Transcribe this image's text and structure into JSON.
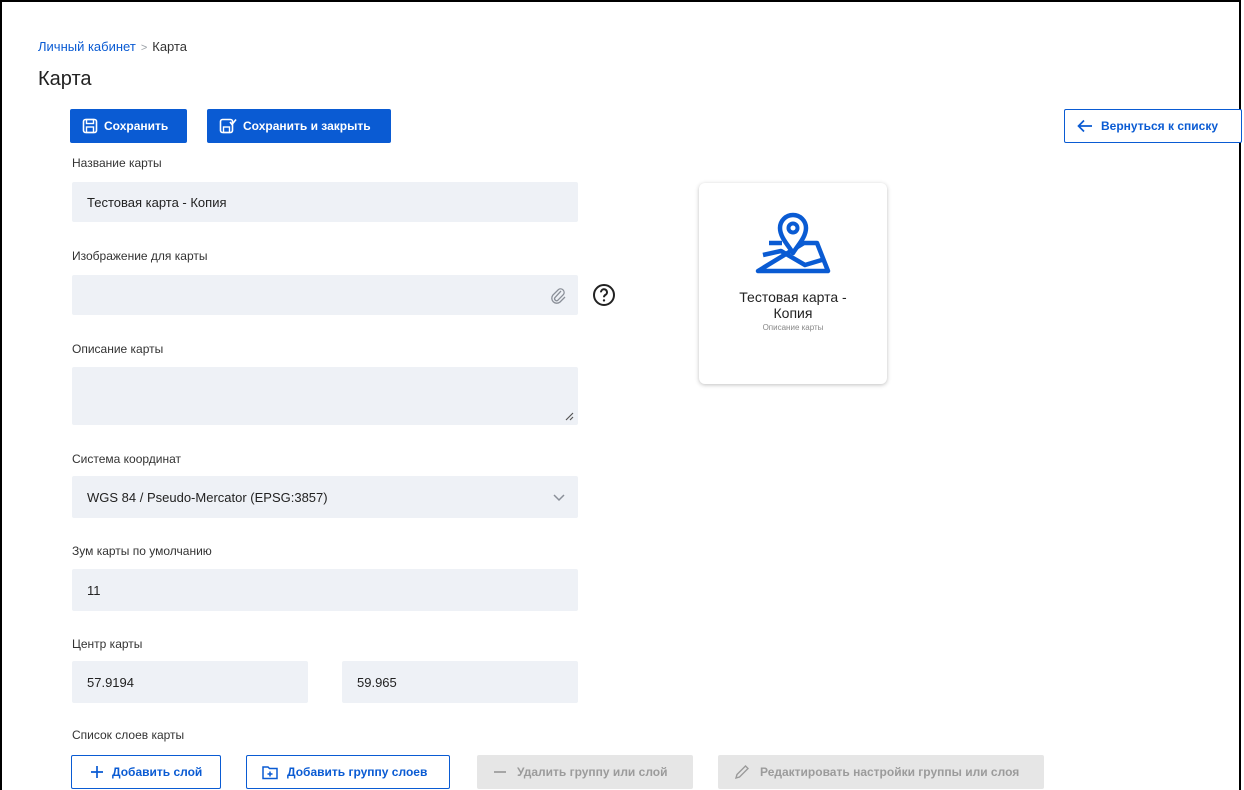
{
  "breadcrumb": {
    "home": "Личный кабинет",
    "separator": ">",
    "current": "Карта"
  },
  "page_title": "Карта",
  "toolbar": {
    "save_label": "Сохранить",
    "save_close_label": "Сохранить и закрыть",
    "back_label": "Вернуться к списку"
  },
  "form": {
    "name": {
      "label": "Название карты",
      "value": "Тестовая карта - Копия"
    },
    "image": {
      "label": "Изображение для карты",
      "value": ""
    },
    "description": {
      "label": "Описание карты",
      "value": ""
    },
    "crs": {
      "label": "Система координат",
      "value": "WGS 84 / Pseudo-Mercator (EPSG:3857)"
    },
    "zoom": {
      "label": "Зум карты по умолчанию",
      "value": "11"
    },
    "center": {
      "label": "Центр карты",
      "lat": "57.9194",
      "lon": "59.965"
    },
    "layers": {
      "label": "Список слоев карты"
    }
  },
  "layer_buttons": {
    "add_layer": "Добавить слой",
    "add_group": "Добавить группу слоев",
    "delete": "Удалить группу или слой",
    "edit": "Редактировать настройки группы или слоя"
  },
  "preview": {
    "title": "Тестовая карта - Копия",
    "description": "Описание карты"
  },
  "colors": {
    "accent": "#0a5bd3",
    "field_bg": "#eef1f6",
    "disabled_bg": "#e6e6e6",
    "disabled_text": "#9b9b9b"
  },
  "icons": {
    "save": "save-icon",
    "save_close": "save-close-icon",
    "back": "arrow-left-icon",
    "attach": "paperclip-icon",
    "help": "question-circle-icon",
    "dropdown": "chevron-down-icon",
    "map": "map-pin-icon",
    "add": "plus-icon",
    "add_folder": "folder-plus-icon",
    "delete": "minus-icon",
    "edit": "pencil-icon"
  }
}
